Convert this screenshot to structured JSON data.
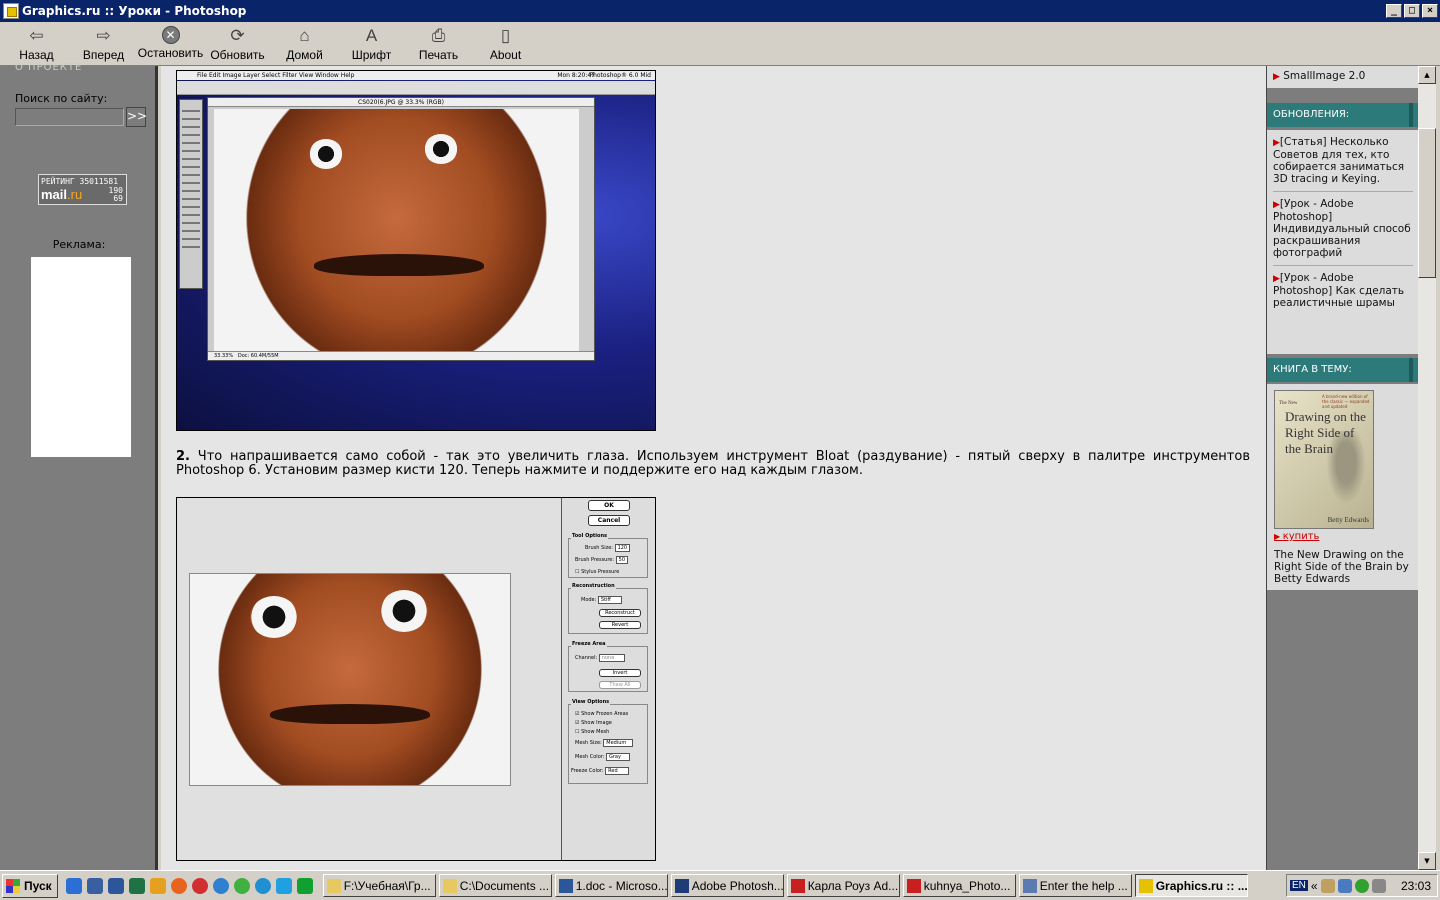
{
  "window": {
    "title": "Graphics.ru :: Уроки - Photoshop",
    "min": "_",
    "max": "□",
    "close": "×"
  },
  "toolbar": {
    "back": "Назад",
    "forward": "Вперед",
    "stop": "Остановить",
    "refresh": "Обновить",
    "home": "Домой",
    "font": "Шрифт",
    "print": "Печать",
    "about": "About"
  },
  "left": {
    "cut_text": "О ПРОЕКТЕ",
    "search_label": "Поиск по сайту:",
    "search_go": ">>",
    "rating_line1": "РЕЙТИНГ 35011581",
    "rating_mail": "mail",
    "rating_ru": ".ru",
    "rating_n1": "190",
    "rating_n2": "69",
    "ad_label": "Реклама:"
  },
  "content": {
    "shot1_menu": "File  Edit  Image  Layer  Select  Filter  View  Window  Help",
    "shot1_clock": "Mon 8:20:47",
    "shot1_app": "Photoshop® 6.0 Mid",
    "shot1_doc": "CS020(6.JPG @ 33.3% (RGB)",
    "shot1_zoom": "33.33%",
    "shot1_size": "Doc: 60.4M/55M",
    "step_num": "2.",
    "step_text": " Что напрашивается само собой - так это увеличить глаза. Используем инструмент Bloat (раздувание) - пятый сверху в палитре инструментов Photoshop 6. Установим размер кисти 120. Теперь нажмите и поддержите его над каждым глазом.",
    "liq_ok": "OK",
    "liq_cancel": "Cancel",
    "liq_tool_options": "Tool Options",
    "liq_brush_size": "Brush Size:",
    "liq_brush_size_val": "120",
    "liq_brush_pressure": "Brush Pressure:",
    "liq_brush_pressure_val": "50",
    "liq_stylus": "Stylus Pressure",
    "liq_reconstruction": "Reconstruction",
    "liq_mode": "Mode:",
    "liq_mode_val": "Stiff",
    "liq_reconstruct": "Reconstruct",
    "liq_revert": "Revert",
    "liq_freeze_area": "Freeze Area",
    "liq_channel": "Channel:",
    "liq_channel_val": "none",
    "liq_invert": "Invert",
    "liq_thaw_all": "Thaw All",
    "liq_view_options": "View Options",
    "liq_show_frozen": "Show Frozen Areas",
    "liq_show_image": "Show Image",
    "liq_show_mesh": "Show Mesh",
    "liq_mesh_size": "Mesh Size:",
    "liq_mesh_size_val": "Medium",
    "liq_mesh_color": "Mesh Color:",
    "liq_mesh_color_val": "Gray",
    "liq_freeze_color": "Freeze Color:",
    "liq_freeze_color_val": "Red"
  },
  "right": {
    "top_item": "SmallImage 2.0",
    "updates_head": "ОБНОВЛЕНИЯ:",
    "updates": [
      "[Статья] Несколько Советов для тех, кто собирается заниматься 3D tracing и Keying.",
      "[Урок - Adobe Photoshop] Индивидуальный способ раскрашивания фотографий",
      "[Урок - Adobe Photoshop] Как сделать реалистичные шрамы"
    ],
    "book_head": "КНИГА В ТЕМУ:",
    "book_cover_the": "The New",
    "book_cover_title": "Drawing on the Right Side of the Brain",
    "book_cover_sub": "A brand-new edition of the classic — expanded and updated",
    "book_cover_author": "Betty Edwards",
    "buy": "купить",
    "book_title": "The New Drawing on the Right Side of the Brain by Betty Edwards"
  },
  "scroll": {
    "up": "▲",
    "down": "▼"
  },
  "taskbar": {
    "start": "Пуск",
    "tasks": [
      "F:\\Учебная\\Гр...",
      "C:\\Documents ...",
      "1.doc - Microso...",
      "Adobe Photosh...",
      "Карла Роуз Ad...",
      "kuhnya_Photo...",
      "Enter the help ...",
      "Graphics.ru :: ..."
    ],
    "lang": "EN",
    "chev": "«",
    "clock": "23:03"
  },
  "colors": {
    "panel_gray": "#7d7d7d",
    "teal_header": "#2c7a7a",
    "content_bg": "#e5e5e5",
    "link_red": "#cc0000"
  }
}
